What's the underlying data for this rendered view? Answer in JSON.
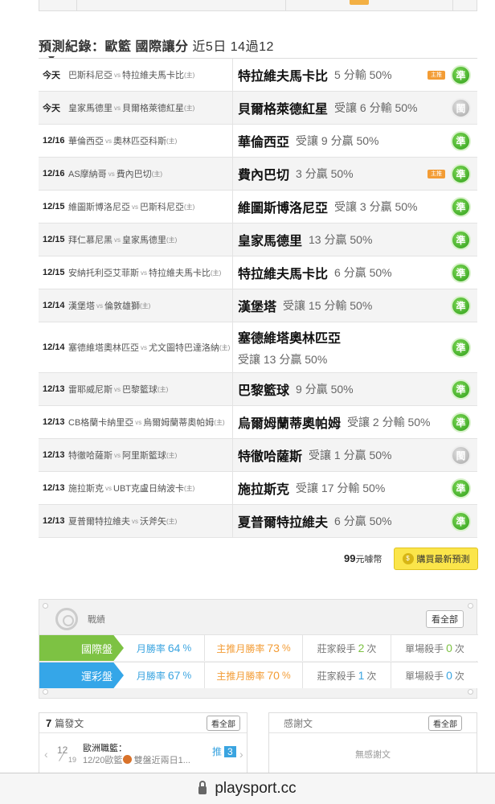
{
  "section_title": {
    "prefix": "預測紀錄：",
    "league": "歐籃 國際讓分",
    "stats": "近5日 14過12"
  },
  "predictions": [
    {
      "date": "今天",
      "away": "巴斯科尼亞",
      "home": "特拉維夫馬卡比",
      "pick_team": "特拉維夫馬卡比",
      "pick_line": "5 分輸 50%",
      "flag": true,
      "result": "準",
      "result_type": "win"
    },
    {
      "date": "今天",
      "away": "皇家馬德里",
      "home": "貝爾格萊德紅星",
      "pick_team": "貝爾格萊德紅星",
      "pick_line": "受讓 6 分輸 50%",
      "flag": false,
      "result": "閩",
      "result_type": "draw"
    },
    {
      "date": "12/16",
      "away": "華倫西亞",
      "home": "奧林匹亞科斯",
      "pick_team": "華倫西亞",
      "pick_line": "受讓 9 分贏 50%",
      "flag": false,
      "result": "準",
      "result_type": "win"
    },
    {
      "date": "12/16",
      "away": "AS摩納哥",
      "home": "費內巴切",
      "pick_team": "費內巴切",
      "pick_line": "3 分贏 50%",
      "flag": true,
      "result": "準",
      "result_type": "win"
    },
    {
      "date": "12/15",
      "away": "維圖斯博洛尼亞",
      "home": "巴斯科尼亞",
      "pick_team": "維圖斯博洛尼亞",
      "pick_line": "受讓 3 分贏 50%",
      "flag": false,
      "result": "準",
      "result_type": "win"
    },
    {
      "date": "12/15",
      "away": "拜仁慕尼黑",
      "home": "皇家馬德里",
      "pick_team": "皇家馬德里",
      "pick_line": "13 分贏 50%",
      "flag": false,
      "result": "準",
      "result_type": "win"
    },
    {
      "date": "12/15",
      "away": "安納托利亞艾菲斯",
      "home": "特拉維夫馬卡比",
      "pick_team": "特拉維夫馬卡比",
      "pick_line": "6 分贏 50%",
      "flag": false,
      "result": "準",
      "result_type": "win"
    },
    {
      "date": "12/14",
      "away": "漢堡塔",
      "home": "倫敦雄獅",
      "pick_team": "漢堡塔",
      "pick_line": "受讓 15 分輸 50%",
      "flag": false,
      "result": "準",
      "result_type": "win"
    },
    {
      "date": "12/14",
      "away": "塞德維塔奧林匹亞",
      "home": "尤文圖特巴達洛納",
      "pick_team": "塞德維塔奧林匹亞",
      "pick_line": "受讓 13 分贏 50%",
      "flag": false,
      "result": "準",
      "result_type": "win",
      "tall": true
    },
    {
      "date": "12/13",
      "away": "雷耶威尼斯",
      "home": "巴黎籃球",
      "pick_team": "巴黎籃球",
      "pick_line": "9 分贏 50%",
      "flag": false,
      "result": "準",
      "result_type": "win"
    },
    {
      "date": "12/13",
      "away": "CB格蘭卡納里亞",
      "home": "烏爾姆蘭蒂奧帕姆",
      "pick_team": "烏爾姆蘭蒂奧帕姆",
      "pick_line": "受讓 2 分輸 50%",
      "flag": false,
      "result": "準",
      "result_type": "win"
    },
    {
      "date": "12/13",
      "away": "特徹哈薩斯",
      "home": "阿里斯籃球",
      "pick_team": "特徹哈薩斯",
      "pick_line": "受讓 1 分贏 50%",
      "flag": false,
      "result": "閩",
      "result_type": "draw"
    },
    {
      "date": "12/13",
      "away": "施拉斯克",
      "home": "UBT克盧日納波卡",
      "pick_team": "施拉斯克",
      "pick_line": "受讓 17 分輸 50%",
      "flag": false,
      "result": "準",
      "result_type": "win"
    },
    {
      "date": "12/13",
      "away": "夏普爾特拉維夫",
      "home": "沃斧矢",
      "pick_team": "夏普爾特拉維夫",
      "pick_line": "6 分贏 50%",
      "flag": false,
      "result": "準",
      "result_type": "win"
    }
  ],
  "vs_label": "vs",
  "home_marker": "(主)",
  "flag_label": "主推",
  "purchase": {
    "price": "99",
    "unit": "元噱幣",
    "button": "購買最新預測"
  },
  "record": {
    "label": "戰績",
    "view_all": "看全部",
    "rows": [
      {
        "name": "國際盤",
        "month_label": "月勝率",
        "month_value": "64",
        "pct": "%",
        "main_label": "主推月勝率",
        "main_value": "73",
        "banker_label": "莊家殺手",
        "banker_value": "2",
        "single_label": "單場殺手",
        "single_value": "0",
        "times": "次"
      },
      {
        "name": "運彩盤",
        "month_label": "月勝率",
        "month_value": "67",
        "pct": "%",
        "main_label": "主推月勝率",
        "main_value": "70",
        "banker_label": "莊家殺手",
        "banker_value": "1",
        "single_label": "單場殺手",
        "single_value": "0",
        "times": "次"
      }
    ]
  },
  "posts": {
    "count": "7",
    "label": "篇發文",
    "view_all": "看全部",
    "item": {
      "month": "12",
      "day": "19",
      "title": "歐洲職籃：",
      "subtitle_date": "12/20歐籃",
      "subtitle_rest": "雙盤近兩日1...",
      "rec_label": "推",
      "rec_count": "3"
    }
  },
  "thanks": {
    "label": "感謝文",
    "view_all": "看全部",
    "empty": "無感謝文"
  },
  "url": "playsport.cc"
}
